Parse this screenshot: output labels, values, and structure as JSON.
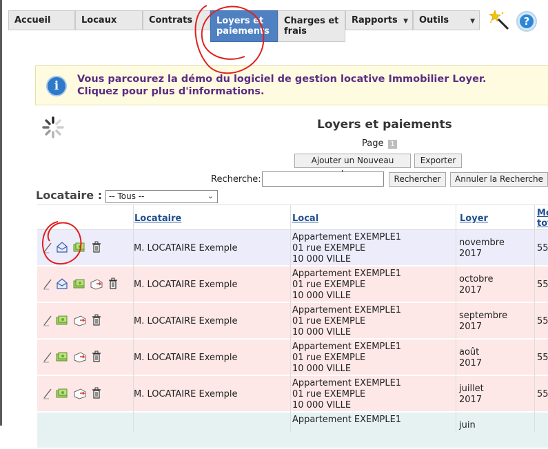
{
  "nav": {
    "items": [
      {
        "id": "accueil",
        "label": "Accueil"
      },
      {
        "id": "locaux",
        "label": "Locaux"
      },
      {
        "id": "contrats",
        "label": "Contrats"
      },
      {
        "id": "loyers",
        "label_l1": "Loyers et",
        "label_l2": "paiements",
        "active": true
      },
      {
        "id": "charges",
        "label_l1": "Charges et",
        "label_l2": "frais"
      },
      {
        "id": "rapports",
        "label": "Rapports",
        "has_dropdown": true
      },
      {
        "id": "outils",
        "label": "Outils",
        "has_dropdown": true
      }
    ],
    "help_glyph": "?"
  },
  "banner": {
    "icon_glyph": "i",
    "line1": "Vous parcourez la démo du logiciel de gestion locative Immobilier Loyer.",
    "line2": "Cliquez pour plus d'informations."
  },
  "page": {
    "title": "Loyers et paiements",
    "page_label": "Page",
    "page_number": "1",
    "add_button": "Ajouter un Nouveau Loyer",
    "export_button": "Exporter"
  },
  "search": {
    "label": "Recherche:",
    "value": "",
    "submit": "Rechercher",
    "cancel": "Annuler la Recherche"
  },
  "filter": {
    "label": "Locataire :",
    "selected": "-- Tous --"
  },
  "table": {
    "headers": {
      "locataire": "Locataire",
      "local": "Local",
      "loyer": "Loyer",
      "montant_l1": "Mo",
      "montant_l2": "tot"
    },
    "rows": [
      {
        "locataire": "M. LOCATAIRE Exemple",
        "local_l1": "Appartement EXEMPLE1",
        "local_l2": "01 rue EXEMPLE",
        "local_l3": "10 000 VILLE",
        "loyer_l1": "novembre",
        "loyer_l2": "2017",
        "montant": "55",
        "color": "lav",
        "icons": [
          "edit-icon",
          "receipt-icon",
          "payment-icon",
          "delete-icon"
        ]
      },
      {
        "locataire": "M. LOCATAIRE Exemple",
        "local_l1": "Appartement EXEMPLE1",
        "local_l2": "01 rue EXEMPLE",
        "local_l3": "10 000 VILLE",
        "loyer_l1": "octobre",
        "loyer_l2": "2017",
        "montant": "55",
        "color": "pink",
        "icons": [
          "edit-icon",
          "receipt-icon",
          "payment-icon",
          "reminder-icon",
          "delete-icon"
        ]
      },
      {
        "locataire": "M. LOCATAIRE Exemple",
        "local_l1": "Appartement EXEMPLE1",
        "local_l2": "01 rue EXEMPLE",
        "local_l3": "10 000 VILLE",
        "loyer_l1": "septembre",
        "loyer_l2": "2017",
        "montant": "55",
        "color": "pink",
        "icons": [
          "edit-icon",
          "payment-icon",
          "reminder-icon",
          "delete-icon"
        ]
      },
      {
        "locataire": "M. LOCATAIRE Exemple",
        "local_l1": "Appartement EXEMPLE1",
        "local_l2": "01 rue EXEMPLE",
        "local_l3": "10 000 VILLE",
        "loyer_l1": "août",
        "loyer_l2": "2017",
        "montant": "55",
        "color": "pink",
        "icons": [
          "edit-icon",
          "payment-icon",
          "reminder-icon",
          "delete-icon"
        ]
      },
      {
        "locataire": "M. LOCATAIRE Exemple",
        "local_l1": "Appartement EXEMPLE1",
        "local_l2": "01 rue EXEMPLE",
        "local_l3": "10 000 VILLE",
        "loyer_l1": "juillet",
        "loyer_l2": "2017",
        "montant": "55",
        "color": "pink",
        "icons": [
          "edit-icon",
          "payment-icon",
          "reminder-icon",
          "delete-icon"
        ]
      },
      {
        "locataire": "",
        "local_l1": "Appartement EXEMPLE1",
        "local_l2": "",
        "local_l3": "",
        "loyer_l1": "juin",
        "loyer_l2": "",
        "montant": "",
        "color": "teal",
        "icons": []
      }
    ]
  },
  "colors": {
    "nav_active": "#4f80c2",
    "banner_text": "#5a2d82",
    "link": "#1f4f8f",
    "row_pink": "#fde7e7",
    "row_lavender": "#ececfb",
    "annotation": "#e0201c"
  }
}
